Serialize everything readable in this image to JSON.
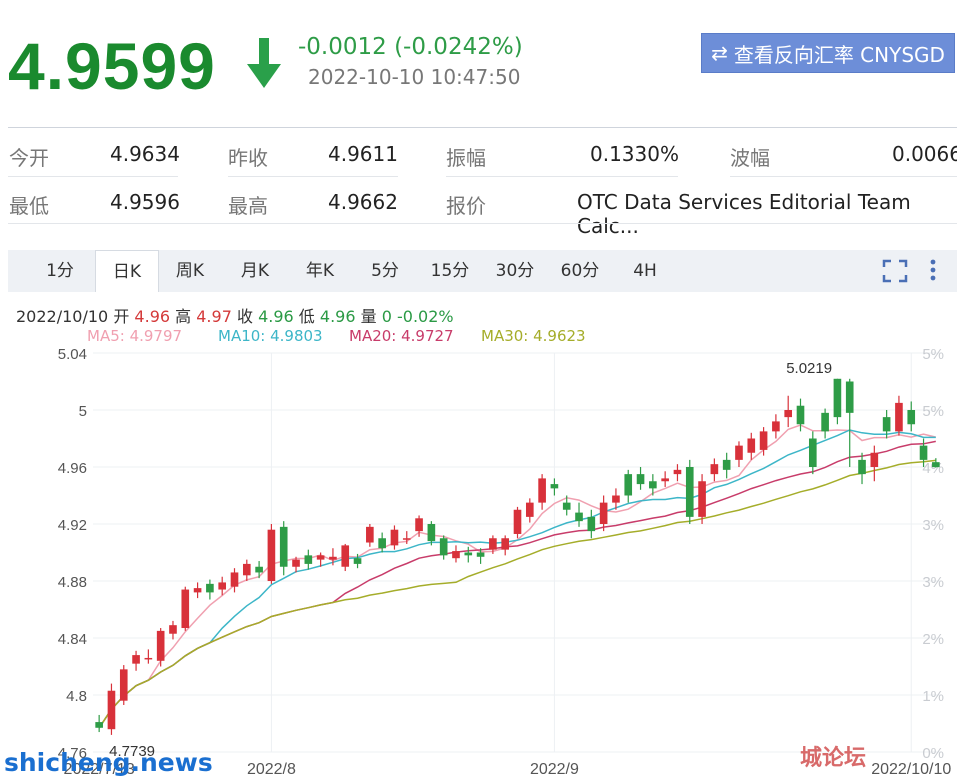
{
  "quote": {
    "price": "4.9599",
    "change": "-0.0012 (-0.0242%)",
    "timestamp": "2022-10-10 10:47:50",
    "reverse_button": "查看反向汇率 CNYSGD",
    "color_down": "#1a8a2e"
  },
  "stats": {
    "open_label": "今开",
    "open": "4.9634",
    "prev_close_label": "昨收",
    "prev_close": "4.9611",
    "amplitude_label": "振幅",
    "amplitude": "0.1330%",
    "wave_label": "波幅",
    "wave": "0.0066",
    "low_label": "最低",
    "low": "4.9596",
    "high_label": "最高",
    "high": "4.9662",
    "quote_label": "报价",
    "quote_source": "OTC Data Services Editorial Team Calc..."
  },
  "tabs": [
    "1分",
    "日K",
    "周K",
    "月K",
    "年K",
    "5分",
    "15分",
    "30分",
    "60分",
    "4H"
  ],
  "active_tab": "日K",
  "ohlc": {
    "date": "2022/10/10",
    "open_label": "开",
    "open": "4.96",
    "high_label": "高",
    "high": "4.97",
    "close_label": "收",
    "close": "4.96",
    "low_label": "低",
    "low": "4.96",
    "vol_label": "量",
    "vol": "0",
    "pct": "-0.02%"
  },
  "ma_legend": [
    {
      "label": "MA5: 4.9797",
      "color": "#f0a0b0"
    },
    {
      "label": "MA10: 4.9803",
      "color": "#3db6c8"
    },
    {
      "label": "MA20: 4.9727",
      "color": "#c83c6a"
    },
    {
      "label": "MA30: 4.9623",
      "color": "#a5ad2a"
    }
  ],
  "watermarks": {
    "left": "shicheng.news",
    "right": "城论坛"
  },
  "chart_data": {
    "type": "candlestick",
    "y_ticks": [
      "5.04",
      "5",
      "4.96",
      "4.92",
      "4.88",
      "4.84",
      "4.8",
      "4.76"
    ],
    "ylim": [
      4.76,
      5.04
    ],
    "pct_ticks": [
      "5%",
      "5%",
      "4%",
      "3%",
      "3%",
      "2%",
      "1%",
      "0%"
    ],
    "x_labels": [
      {
        "label": "2022/7/13",
        "index": 0
      },
      {
        "label": "2022/8",
        "index": 14
      },
      {
        "label": "2022/9",
        "index": 37
      },
      {
        "label": "2022/10/10",
        "index": 66
      }
    ],
    "annotations": [
      {
        "text": "5.0219",
        "index": 56,
        "value": 5.0219
      },
      {
        "text": "4.7739",
        "index": 0,
        "value": 4.7739
      }
    ],
    "candles": [
      [
        4.781,
        4.777,
        4.786,
        4.774
      ],
      [
        4.776,
        4.803,
        4.808,
        4.772
      ],
      [
        4.796,
        4.818,
        4.821,
        4.793
      ],
      [
        4.822,
        4.828,
        4.831,
        4.817
      ],
      [
        4.826,
        4.826,
        4.832,
        4.822
      ],
      [
        4.824,
        4.845,
        4.847,
        4.82
      ],
      [
        4.843,
        4.849,
        4.852,
        4.839
      ],
      [
        4.847,
        4.874,
        4.876,
        4.845
      ],
      [
        4.872,
        4.875,
        4.879,
        4.868
      ],
      [
        4.878,
        4.872,
        4.881,
        4.867
      ],
      [
        4.874,
        4.879,
        4.883,
        4.87
      ],
      [
        4.876,
        4.886,
        4.889,
        4.872
      ],
      [
        4.884,
        4.892,
        4.895,
        4.88
      ],
      [
        4.89,
        4.886,
        4.894,
        4.882
      ],
      [
        4.88,
        4.916,
        4.92,
        4.878
      ],
      [
        4.918,
        4.89,
        4.922,
        4.884
      ],
      [
        4.89,
        4.895,
        4.897,
        4.886
      ],
      [
        4.898,
        4.892,
        4.902,
        4.888
      ],
      [
        4.895,
        4.898,
        4.9,
        4.89
      ],
      [
        4.895,
        4.897,
        4.903,
        4.891
      ],
      [
        4.89,
        4.905,
        4.906,
        4.887
      ],
      [
        4.896,
        4.892,
        4.899,
        4.889
      ],
      [
        4.907,
        4.918,
        4.92,
        4.904
      ],
      [
        4.91,
        4.903,
        4.914,
        4.9
      ],
      [
        4.905,
        4.916,
        4.919,
        4.902
      ],
      [
        4.91,
        4.91,
        4.915,
        4.906
      ],
      [
        4.915,
        4.924,
        4.926,
        4.911
      ],
      [
        4.92,
        4.908,
        4.922,
        4.905
      ],
      [
        4.91,
        4.898,
        4.912,
        4.895
      ],
      [
        4.896,
        4.901,
        4.905,
        4.893
      ],
      [
        4.9,
        4.898,
        4.904,
        4.893
      ],
      [
        4.9,
        4.897,
        4.903,
        4.892
      ],
      [
        4.902,
        4.91,
        4.912,
        4.899
      ],
      [
        4.902,
        4.91,
        4.912,
        4.898
      ],
      [
        4.913,
        4.93,
        4.932,
        4.91
      ],
      [
        4.925,
        4.935,
        4.938,
        4.921
      ],
      [
        4.935,
        4.952,
        4.955,
        4.93
      ],
      [
        4.948,
        4.945,
        4.952,
        4.94
      ],
      [
        4.935,
        4.93,
        4.94,
        4.926
      ],
      [
        4.928,
        4.922,
        4.935,
        4.918
      ],
      [
        4.925,
        4.915,
        4.93,
        4.91
      ],
      [
        4.92,
        4.935,
        4.94,
        4.915
      ],
      [
        4.935,
        4.94,
        4.945,
        4.93
      ],
      [
        4.955,
        4.94,
        4.958,
        4.935
      ],
      [
        4.955,
        4.948,
        4.96,
        4.944
      ],
      [
        4.95,
        4.945,
        4.955,
        4.94
      ],
      [
        4.95,
        4.952,
        4.957,
        4.946
      ],
      [
        4.955,
        4.958,
        4.962,
        4.95
      ],
      [
        4.96,
        4.925,
        4.965,
        4.92
      ],
      [
        4.925,
        4.95,
        4.955,
        4.92
      ],
      [
        4.955,
        4.962,
        4.966,
        4.95
      ],
      [
        4.965,
        4.958,
        4.97,
        4.952
      ],
      [
        4.965,
        4.975,
        4.978,
        4.96
      ],
      [
        4.97,
        4.98,
        4.984,
        4.965
      ],
      [
        4.972,
        4.985,
        4.988,
        4.968
      ],
      [
        4.985,
        4.992,
        4.997,
        4.98
      ],
      [
        4.995,
        5.0,
        5.01,
        4.988
      ],
      [
        5.003,
        4.99,
        5.008,
        4.985
      ],
      [
        4.98,
        4.96,
        4.985,
        4.955
      ],
      [
        4.998,
        4.985,
        5.001,
        4.98
      ],
      [
        5.0219,
        4.995,
        5.0219,
        4.99
      ],
      [
        5.02,
        4.998,
        5.0219,
        4.96
      ],
      [
        4.965,
        4.955,
        4.97,
        4.948
      ],
      [
        4.96,
        4.97,
        4.975,
        4.95
      ],
      [
        4.995,
        4.985,
        5.0,
        4.98
      ],
      [
        4.985,
        5.005,
        5.01,
        4.982
      ],
      [
        5.0,
        4.99,
        5.006,
        4.985
      ],
      [
        4.975,
        4.965,
        4.98,
        4.96
      ],
      [
        4.9634,
        4.9599,
        4.9662,
        4.9596
      ]
    ]
  }
}
